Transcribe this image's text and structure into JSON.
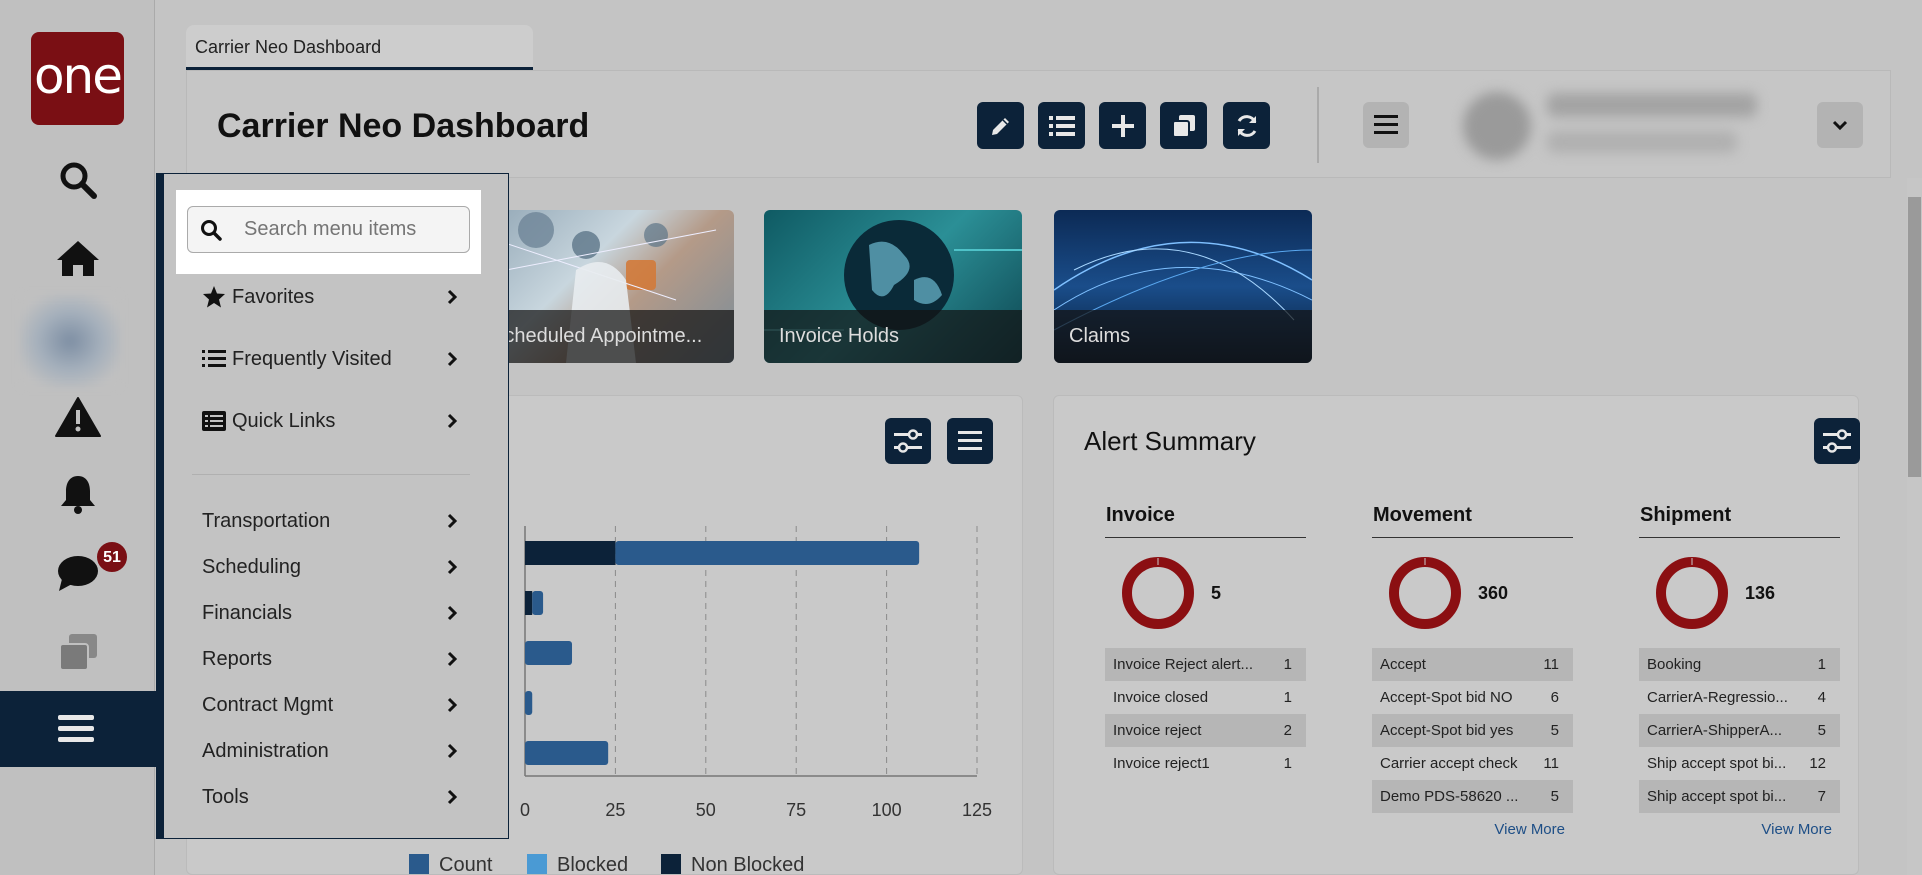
{
  "app": {
    "logo_text": "one",
    "tab_title": "Carrier Neo Dashboard",
    "page_title": "Carrier Neo Dashboard",
    "chat_badge": "51"
  },
  "rail": {
    "icons": [
      "search-icon",
      "home-icon",
      "alert-icon",
      "bell-icon",
      "chat-icon",
      "windows-icon",
      "menu-icon"
    ]
  },
  "toolbar": {
    "buttons": [
      "edit-icon",
      "list-icon",
      "plus-icon",
      "copy-icon",
      "refresh-icon"
    ]
  },
  "tiles": [
    {
      "label": "Scheduled Appointme..."
    },
    {
      "label": "Invoice Holds"
    },
    {
      "label": "Claims"
    }
  ],
  "menu": {
    "search_placeholder": "Search menu items",
    "top_items": [
      {
        "label": "Favorites",
        "icon": "star-icon"
      },
      {
        "label": "Frequently Visited",
        "icon": "list-ol-icon"
      },
      {
        "label": "Quick Links",
        "icon": "list-alt-icon"
      }
    ],
    "items": [
      {
        "label": "Transportation"
      },
      {
        "label": "Scheduling"
      },
      {
        "label": "Financials"
      },
      {
        "label": "Reports"
      },
      {
        "label": "Contract Mgmt"
      },
      {
        "label": "Administration"
      },
      {
        "label": "Tools"
      }
    ]
  },
  "chart_data": {
    "type": "bar",
    "orientation": "horizontal",
    "stacked": true,
    "xlim": [
      0,
      125
    ],
    "xticks": [
      "0",
      "25",
      "50",
      "75",
      "100",
      "125"
    ],
    "series": [
      {
        "name": "Count",
        "color": "#2a5a8c",
        "values": [
          109,
          5,
          13,
          2,
          23
        ]
      },
      {
        "name": "Blocked",
        "color": "#4a9ad4",
        "values": [
          0,
          0,
          0,
          0,
          0
        ]
      },
      {
        "name": "Non Blocked",
        "color": "#0c2239",
        "values": [
          25,
          2,
          0,
          0,
          0
        ]
      }
    ],
    "legend": [
      "Count",
      "Blocked",
      "Non Blocked"
    ],
    "legend_position": "bottom",
    "grid": true
  },
  "alert_summary": {
    "title": "Alert Summary",
    "columns": [
      {
        "name": "Invoice",
        "total": "5",
        "rows": [
          {
            "label": "Invoice Reject alert...",
            "count": "1"
          },
          {
            "label": "Invoice closed",
            "count": "1"
          },
          {
            "label": "Invoice reject",
            "count": "2"
          },
          {
            "label": "Invoice reject1",
            "count": "1"
          }
        ],
        "view_more": ""
      },
      {
        "name": "Movement",
        "total": "360",
        "rows": [
          {
            "label": "Accept",
            "count": "11"
          },
          {
            "label": "Accept-Spot bid NO",
            "count": "6"
          },
          {
            "label": "Accept-Spot bid yes",
            "count": "5"
          },
          {
            "label": "Carrier accept check",
            "count": "11"
          },
          {
            "label": "Demo PDS-58620 ...",
            "count": "5"
          }
        ],
        "view_more": "View More"
      },
      {
        "name": "Shipment",
        "total": "136",
        "rows": [
          {
            "label": "Booking",
            "count": "1"
          },
          {
            "label": "CarrierA-Regressio...",
            "count": "4"
          },
          {
            "label": "CarrierA-ShipperA...",
            "count": "5"
          },
          {
            "label": "Ship accept spot bi...",
            "count": "12"
          },
          {
            "label": "Ship accept spot bi...",
            "count": "7"
          }
        ],
        "view_more": "View More"
      }
    ]
  },
  "colors": {
    "navy": "#0c2239",
    "brand_red": "#7a0f14",
    "donut": "#8b0f12"
  }
}
